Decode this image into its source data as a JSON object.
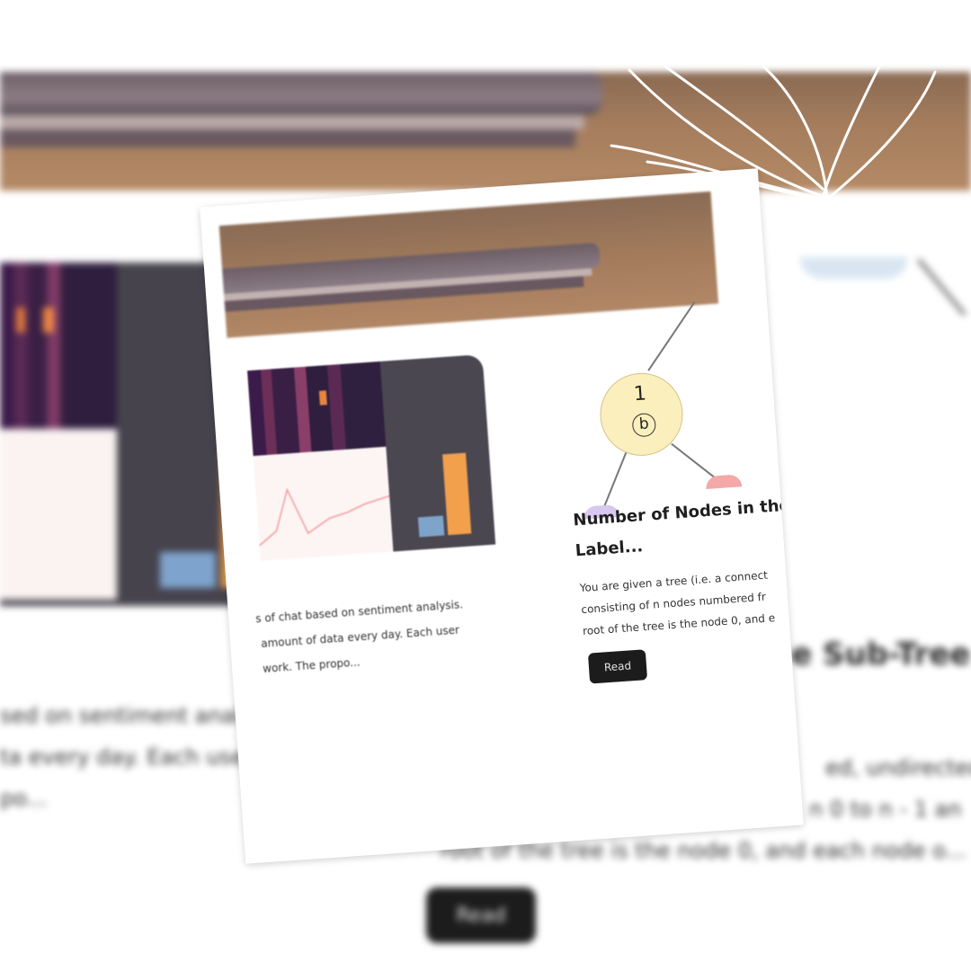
{
  "background": {
    "left_card": {
      "excerpt_lines": [
        "sed on sentiment analy",
        "ta every day. Each user",
        "po..."
      ]
    },
    "right_card": {
      "title": "e Sub-Tree",
      "excerpt_lines": [
        "ed, undirected",
        "n 0 to n - 1 an",
        "root of the tree is the node 0, and each node o..."
      ],
      "read_label": "Read"
    }
  },
  "front_card": {
    "left_post": {
      "excerpt_lines": [
        "s of chat based on sentiment analysis.",
        "amount of data every day. Each user",
        "work. The propo..."
      ]
    },
    "right_post": {
      "tree_node_number": "1",
      "tree_node_letter": "b",
      "title_lines": [
        "Number of Nodes in the",
        "Label..."
      ],
      "excerpt_lines": [
        "You are given a tree (i.e. a connect",
        "consisting of n nodes numbered fr",
        "root of the tree is the node 0, and e"
      ],
      "read_label": "Read"
    }
  },
  "colors": {
    "accent_orange": "#f3a14d",
    "accent_blue": "#7ea3cc",
    "button_dark": "#1c1c1c",
    "node_fill": "#fbefbd"
  }
}
